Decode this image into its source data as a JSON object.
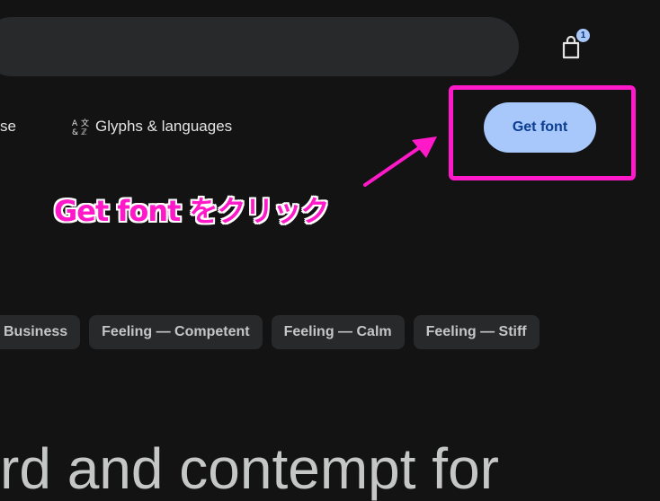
{
  "header": {
    "bag_badge_count": "1",
    "bag_icon": "shopping-bag-icon"
  },
  "nav": {
    "partial_item_label": "se",
    "glyphs_icon": "glyphs-icon",
    "glyphs_label": "Glyphs & languages"
  },
  "actions": {
    "get_font_label": "Get font"
  },
  "annotation": {
    "text": "Get font をクリック",
    "color": "#ff19c8"
  },
  "tags": [
    {
      "label": "Business"
    },
    {
      "label": "Feeling — Competent"
    },
    {
      "label": "Feeling — Calm"
    },
    {
      "label": "Feeling — Stiff"
    }
  ],
  "preview": {
    "text": "rd and contempt for"
  },
  "colors": {
    "background": "#131314",
    "surface": "#28292b",
    "accent": "#a8c7fa",
    "highlight": "#ff19c8"
  }
}
